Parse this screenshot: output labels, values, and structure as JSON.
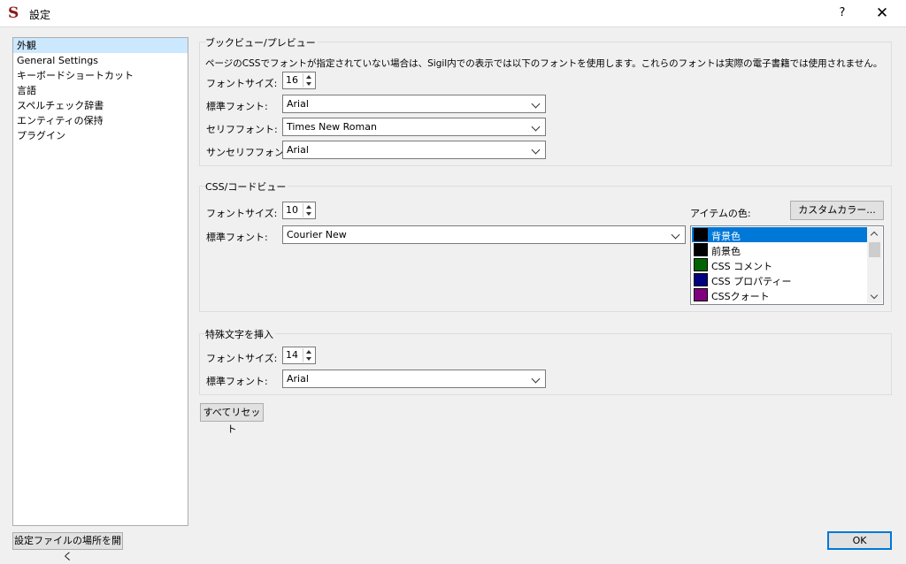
{
  "window": {
    "title": "設定",
    "help_label": "?",
    "close_label": "✕"
  },
  "sidebar": {
    "items": [
      {
        "label": "外観"
      },
      {
        "label": "General Settings"
      },
      {
        "label": "キーボードショートカット"
      },
      {
        "label": "言語"
      },
      {
        "label": "スペルチェック辞書"
      },
      {
        "label": "エンティティの保持"
      },
      {
        "label": "プラグイン"
      }
    ],
    "selected": "外観",
    "open_folder_label": "設定ファイルの場所を開く"
  },
  "bookview": {
    "title": "ブックビュー/プレビュー",
    "note": "ページのCSSでフォントが指定されていない場合は、Sigil内での表示では以下のフォントを使用します。これらのフォントは実際の電子書籍では使用されません。",
    "font_size_label": "フォントサイズ:",
    "font_size": "16",
    "standard_font_label": "標準フォント:",
    "standard_font": "Arial",
    "serif_font_label": "セリフフォント:",
    "serif_font": "Times New Roman",
    "sans_font_label": "サンセリフフォント:",
    "sans_font": "Arial"
  },
  "codeview": {
    "title": "CSS/コードビュー",
    "font_size_label": "フォントサイズ:",
    "font_size": "10",
    "standard_font_label": "標準フォント:",
    "standard_font": "Courier New",
    "item_color_label": "アイテムの色:",
    "custom_color_label": "カスタムカラー...",
    "color_items": [
      {
        "label": "背景色",
        "color": "#000000"
      },
      {
        "label": "前景色",
        "color": "#000000"
      },
      {
        "label": "CSS コメント",
        "color": "#006400"
      },
      {
        "label": "CSS プロパティー",
        "color": "#000080"
      },
      {
        "label": "CSSクォート",
        "color": "#800080"
      }
    ],
    "selected_color_item": "背景色"
  },
  "special_chars": {
    "title": "特殊文字を挿入",
    "font_size_label": "フォントサイズ:",
    "font_size": "14",
    "standard_font_label": "標準フォント:",
    "standard_font": "Arial"
  },
  "buttons": {
    "reset_all_label": "すべてリセット",
    "ok_label": "OK"
  },
  "accent_color": "#0078d7"
}
